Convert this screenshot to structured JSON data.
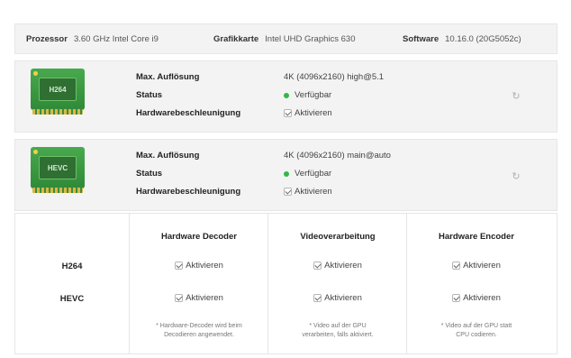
{
  "info": {
    "processor_label": "Prozessor",
    "processor_value": "3.60 GHz Intel Core i9",
    "graphics_label": "Grafikkarte",
    "graphics_value": "Intel UHD Graphics 630",
    "software_label": "Software",
    "software_value": "10.16.0 (20G5052c)"
  },
  "codecs": [
    {
      "chip_label": "H264",
      "max_res_label": "Max. Auflösung",
      "max_res_value": "4K (4096x2160) high@5.1",
      "status_label": "Status",
      "status_value": "Verfügbar",
      "hw_label": "Hardwarebeschleunigung",
      "hw_value": "Aktivieren"
    },
    {
      "chip_label": "HEVC",
      "max_res_label": "Max. Auflösung",
      "max_res_value": "4K (4096x2160) main@auto",
      "status_label": "Status",
      "status_value": "Verfügbar",
      "hw_label": "Hardwarebeschleunigung",
      "hw_value": "Aktivieren"
    }
  ],
  "matrix": {
    "columns": [
      "Hardware Decoder",
      "Videoverarbeitung",
      "Hardware Encoder"
    ],
    "rows": [
      "H264",
      "HEVC"
    ],
    "cell_label": "Aktivieren",
    "notes": [
      "* Hardware-Decoder wird beim\nDecodieren angewendet.",
      "* Video auf der GPU\nverarbeiten, falls aktiviert.",
      "* Video auf der GPU statt\nCPU codieren."
    ]
  },
  "colors": {
    "status_available": "#2fb84a",
    "chip_green": "#3f9a44",
    "panel_bg": "#f3f3f3"
  }
}
